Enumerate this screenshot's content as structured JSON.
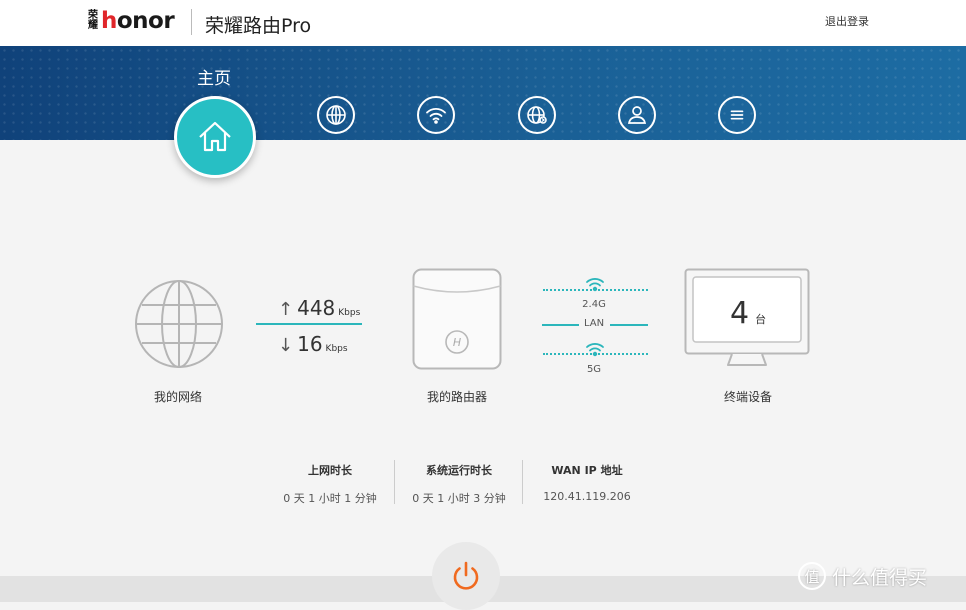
{
  "header": {
    "logo_cn": "荣耀",
    "logo_en_first": "h",
    "logo_en_rest": "onor",
    "product": "荣耀路由Pro",
    "logout": "退出登录"
  },
  "nav": {
    "home_label": "主页",
    "items": [
      "home-icon",
      "globe-icon",
      "wifi-icon",
      "globe-settings-icon",
      "user-icon",
      "menu-icon"
    ]
  },
  "overview": {
    "network_label": "我的网络",
    "upload_value": "448",
    "upload_unit": "Kbps",
    "download_value": "16",
    "download_unit": "Kbps",
    "router_label": "我的路由器",
    "band_24": "2.4G",
    "band_lan": "LAN",
    "band_5": "5G",
    "device_count": "4",
    "device_unit": "台",
    "devices_label": "终端设备"
  },
  "stats": [
    {
      "title": "上网时长",
      "value": "0 天 1 小时 1 分钟"
    },
    {
      "title": "系统运行时长",
      "value": "0 天 1 小时 3 分钟"
    },
    {
      "title": "WAN IP 地址",
      "value": "120.41.119.206"
    }
  ],
  "watermark": {
    "glyph": "值",
    "text": "什么值得买"
  },
  "colors": {
    "accent": "#27bfc4",
    "banner": "#1a5f95",
    "power": "#f06a1f"
  }
}
